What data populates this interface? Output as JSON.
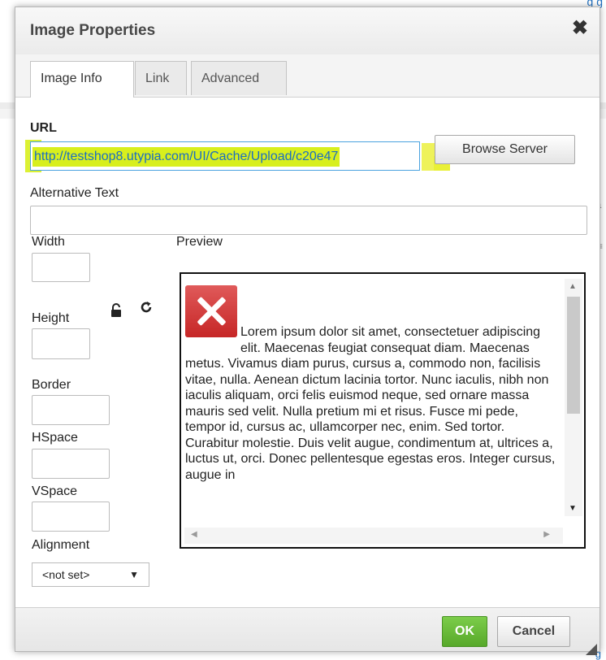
{
  "background": {
    "top_link": "g g",
    "right_char_a": "a",
    "right_char_b": "≡",
    "bottom_link": "g"
  },
  "dialog": {
    "title": "Image Properties",
    "close_glyph": "✖"
  },
  "tabs": [
    {
      "label": "Image Info"
    },
    {
      "label": "Link"
    },
    {
      "label": "Advanced"
    }
  ],
  "form": {
    "url_label": "URL",
    "url_value": "http://testshop8.utypia.com/UI/Cache/Upload/c20e47",
    "browse_button": "Browse Server",
    "alt_label": "Alternative Text",
    "alt_value": "",
    "width_label": "Width",
    "height_label": "Height",
    "border_label": "Border",
    "hspace_label": "HSpace",
    "vspace_label": "VSpace",
    "alignment_label": "Alignment",
    "alignment_value": "<not set>",
    "lock_icon": "lock-icon",
    "reset_icon": "reset-size-icon"
  },
  "preview": {
    "label": "Preview",
    "text": "Lorem ipsum dolor sit amet, consectetuer adipiscing elit. Maecenas feugiat consequat diam. Maecenas metus. Vivamus diam purus, cursus a, commodo non, facilisis vitae, nulla. Aenean dictum lacinia tortor. Nunc iaculis, nibh non iaculis aliquam, orci felis euismod neque, sed ornare massa mauris sed velit. Nulla pretium mi et risus. Fusce mi pede, tempor id, cursus ac, ullamcorper nec, enim. Sed tortor. Curabitur molestie. Duis velit augue, condimentum at, ultrices a, luctus ut, orci. Donec pellentesque egestas eros. Integer cursus, augue in"
  },
  "footer": {
    "ok": "OK",
    "cancel": "Cancel"
  },
  "colors": {
    "highlight": "#d8ef1d",
    "ok_green": "#5cb531",
    "url_text": "#1b6ec2"
  }
}
